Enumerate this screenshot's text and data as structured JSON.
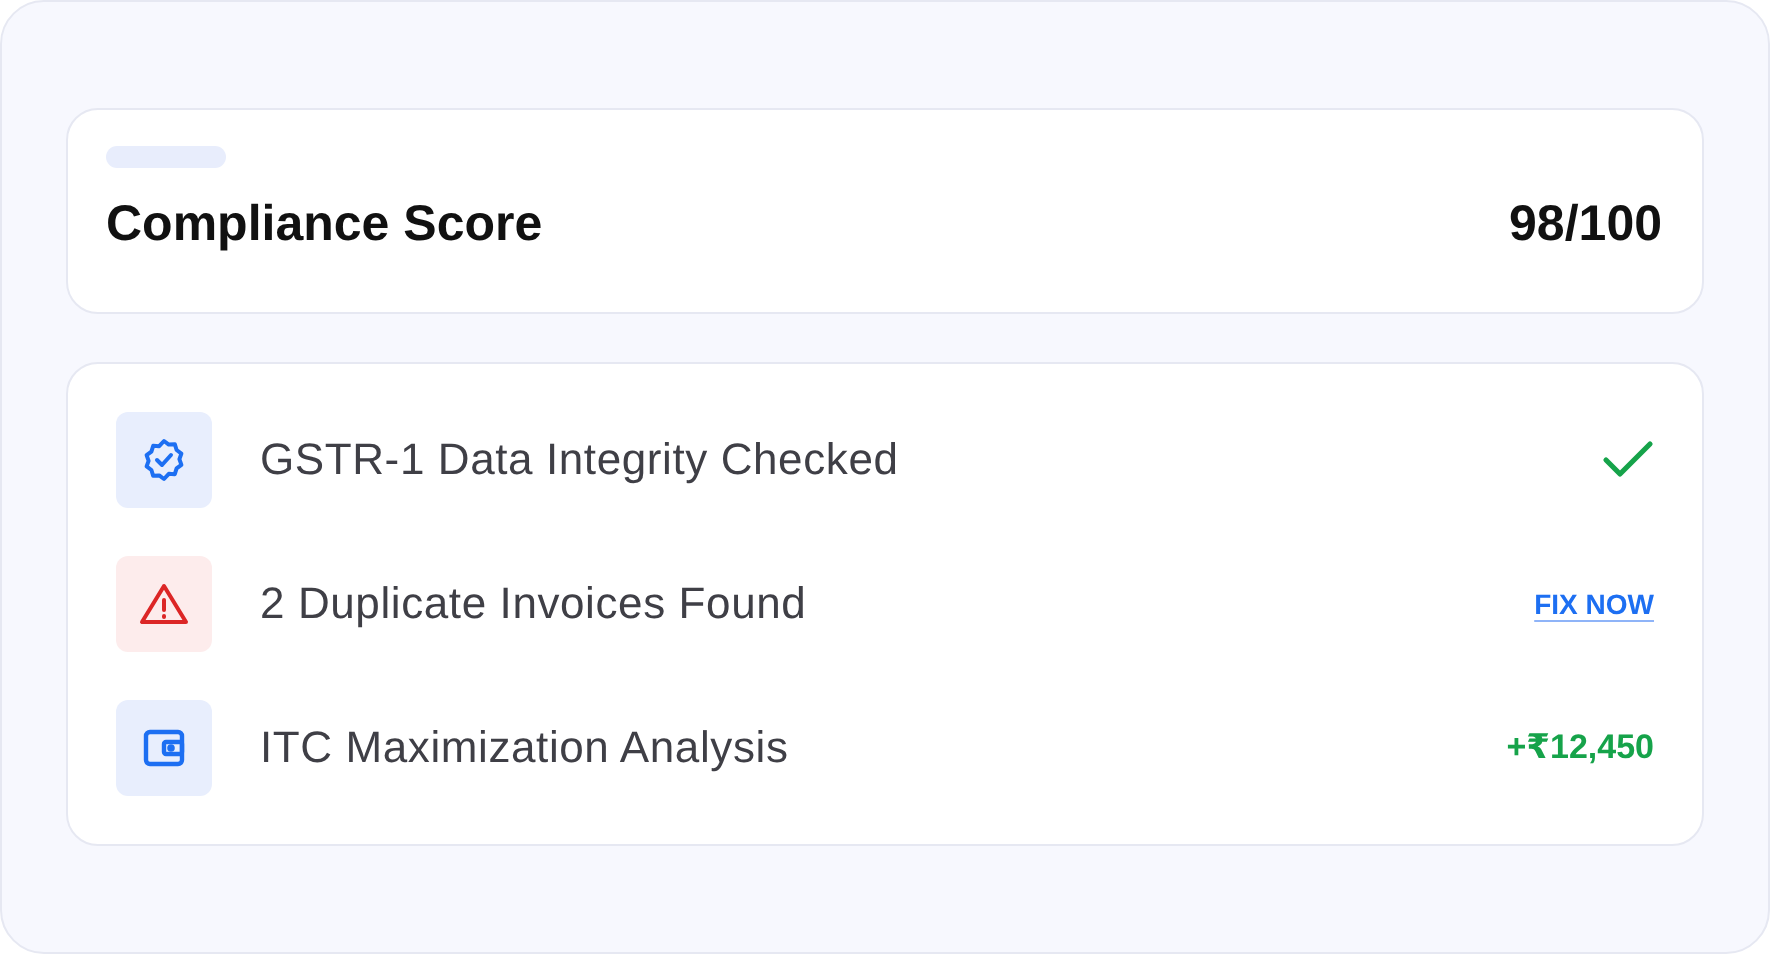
{
  "score_card": {
    "title": "Compliance Score",
    "value": "98/100"
  },
  "checks": [
    {
      "label": "GSTR-1 Data Integrity Checked",
      "kind": "check"
    },
    {
      "label": "2 Duplicate Invoices Found",
      "kind": "action",
      "action": "FIX NOW"
    },
    {
      "label": "ITC Maximization Analysis",
      "kind": "amount",
      "amount": "+₹12,450"
    }
  ]
}
